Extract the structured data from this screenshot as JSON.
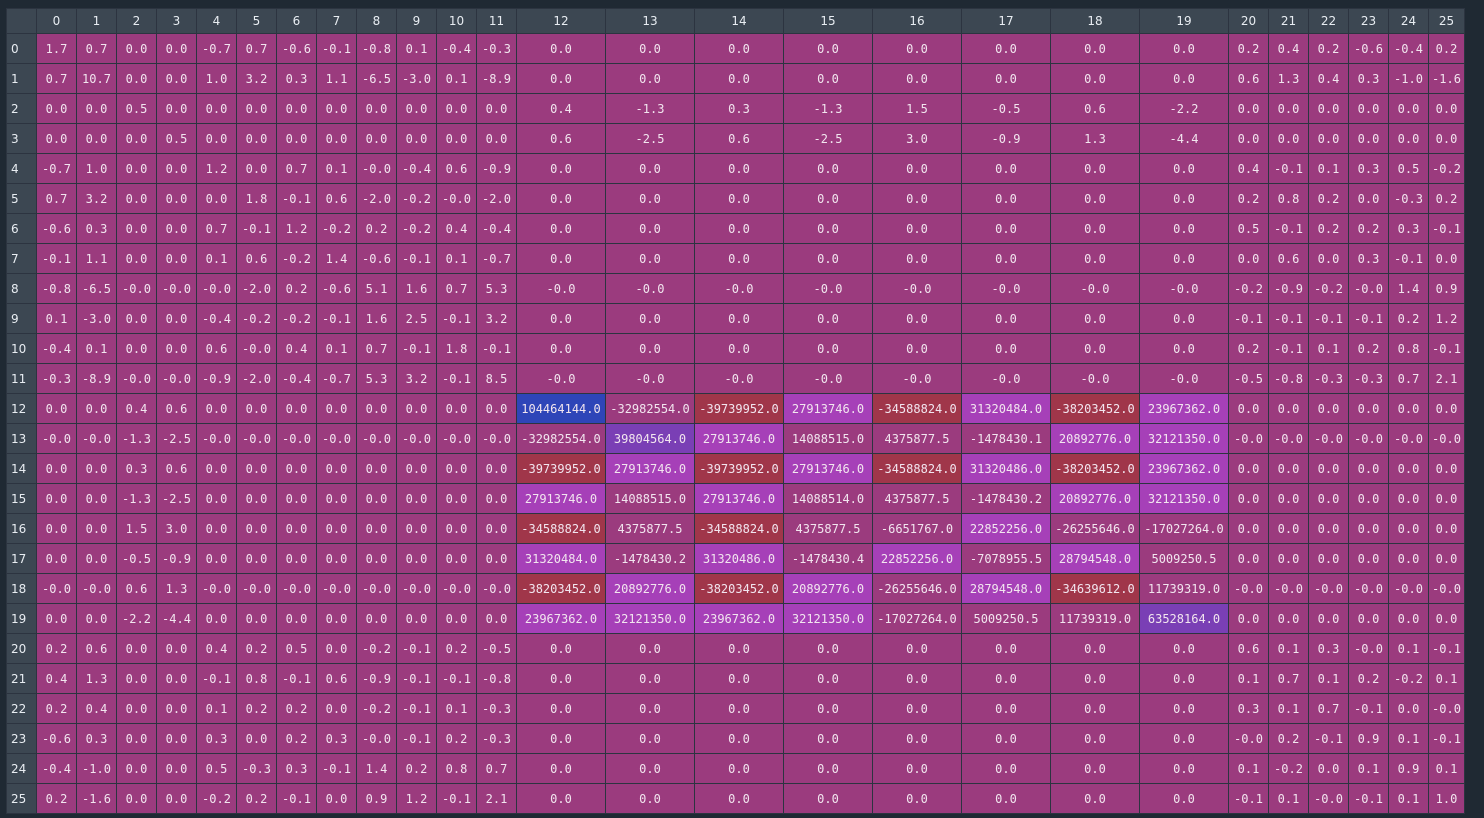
{
  "columns": [
    "0",
    "1",
    "2",
    "3",
    "4",
    "5",
    "6",
    "7",
    "8",
    "9",
    "10",
    "11",
    "12",
    "13",
    "14",
    "15",
    "16",
    "17",
    "18",
    "19",
    "20",
    "21",
    "22",
    "23",
    "24",
    "25"
  ],
  "rows": [
    {
      "label": "0",
      "cells": [
        "1.7",
        "0.7",
        "0.0",
        "0.0",
        "-0.7",
        "0.7",
        "-0.6",
        "-0.1",
        "-0.8",
        "0.1",
        "-0.4",
        "-0.3",
        "0.0",
        "0.0",
        "0.0",
        "0.0",
        "0.0",
        "0.0",
        "0.0",
        "0.0",
        "0.2",
        "0.4",
        "0.2",
        "-0.6",
        "-0.4",
        "0.2"
      ]
    },
    {
      "label": "1",
      "cells": [
        "0.7",
        "10.7",
        "0.0",
        "0.0",
        "1.0",
        "3.2",
        "0.3",
        "1.1",
        "-6.5",
        "-3.0",
        "0.1",
        "-8.9",
        "0.0",
        "0.0",
        "0.0",
        "0.0",
        "0.0",
        "0.0",
        "0.0",
        "0.0",
        "0.6",
        "1.3",
        "0.4",
        "0.3",
        "-1.0",
        "-1.6"
      ]
    },
    {
      "label": "2",
      "cells": [
        "0.0",
        "0.0",
        "0.5",
        "0.0",
        "0.0",
        "0.0",
        "0.0",
        "0.0",
        "0.0",
        "0.0",
        "0.0",
        "0.0",
        "0.4",
        "-1.3",
        "0.3",
        "-1.3",
        "1.5",
        "-0.5",
        "0.6",
        "-2.2",
        "0.0",
        "0.0",
        "0.0",
        "0.0",
        "0.0",
        "0.0"
      ]
    },
    {
      "label": "3",
      "cells": [
        "0.0",
        "0.0",
        "0.0",
        "0.5",
        "0.0",
        "0.0",
        "0.0",
        "0.0",
        "0.0",
        "0.0",
        "0.0",
        "0.0",
        "0.6",
        "-2.5",
        "0.6",
        "-2.5",
        "3.0",
        "-0.9",
        "1.3",
        "-4.4",
        "0.0",
        "0.0",
        "0.0",
        "0.0",
        "0.0",
        "0.0"
      ]
    },
    {
      "label": "4",
      "cells": [
        "-0.7",
        "1.0",
        "0.0",
        "0.0",
        "1.2",
        "0.0",
        "0.7",
        "0.1",
        "-0.0",
        "-0.4",
        "0.6",
        "-0.9",
        "0.0",
        "0.0",
        "0.0",
        "0.0",
        "0.0",
        "0.0",
        "0.0",
        "0.0",
        "0.4",
        "-0.1",
        "0.1",
        "0.3",
        "0.5",
        "-0.2"
      ]
    },
    {
      "label": "5",
      "cells": [
        "0.7",
        "3.2",
        "0.0",
        "0.0",
        "0.0",
        "1.8",
        "-0.1",
        "0.6",
        "-2.0",
        "-0.2",
        "-0.0",
        "-2.0",
        "0.0",
        "0.0",
        "0.0",
        "0.0",
        "0.0",
        "0.0",
        "0.0",
        "0.0",
        "0.2",
        "0.8",
        "0.2",
        "0.0",
        "-0.3",
        "0.2"
      ]
    },
    {
      "label": "6",
      "cells": [
        "-0.6",
        "0.3",
        "0.0",
        "0.0",
        "0.7",
        "-0.1",
        "1.2",
        "-0.2",
        "0.2",
        "-0.2",
        "0.4",
        "-0.4",
        "0.0",
        "0.0",
        "0.0",
        "0.0",
        "0.0",
        "0.0",
        "0.0",
        "0.0",
        "0.5",
        "-0.1",
        "0.2",
        "0.2",
        "0.3",
        "-0.1"
      ]
    },
    {
      "label": "7",
      "cells": [
        "-0.1",
        "1.1",
        "0.0",
        "0.0",
        "0.1",
        "0.6",
        "-0.2",
        "1.4",
        "-0.6",
        "-0.1",
        "0.1",
        "-0.7",
        "0.0",
        "0.0",
        "0.0",
        "0.0",
        "0.0",
        "0.0",
        "0.0",
        "0.0",
        "0.0",
        "0.6",
        "0.0",
        "0.3",
        "-0.1",
        "0.0"
      ]
    },
    {
      "label": "8",
      "cells": [
        "-0.8",
        "-6.5",
        "-0.0",
        "-0.0",
        "-0.0",
        "-2.0",
        "0.2",
        "-0.6",
        "5.1",
        "1.6",
        "0.7",
        "5.3",
        "-0.0",
        "-0.0",
        "-0.0",
        "-0.0",
        "-0.0",
        "-0.0",
        "-0.0",
        "-0.0",
        "-0.2",
        "-0.9",
        "-0.2",
        "-0.0",
        "1.4",
        "0.9"
      ]
    },
    {
      "label": "9",
      "cells": [
        "0.1",
        "-3.0",
        "0.0",
        "0.0",
        "-0.4",
        "-0.2",
        "-0.2",
        "-0.1",
        "1.6",
        "2.5",
        "-0.1",
        "3.2",
        "0.0",
        "0.0",
        "0.0",
        "0.0",
        "0.0",
        "0.0",
        "0.0",
        "0.0",
        "-0.1",
        "-0.1",
        "-0.1",
        "-0.1",
        "0.2",
        "1.2"
      ]
    },
    {
      "label": "10",
      "cells": [
        "-0.4",
        "0.1",
        "0.0",
        "0.0",
        "0.6",
        "-0.0",
        "0.4",
        "0.1",
        "0.7",
        "-0.1",
        "1.8",
        "-0.1",
        "0.0",
        "0.0",
        "0.0",
        "0.0",
        "0.0",
        "0.0",
        "0.0",
        "0.0",
        "0.2",
        "-0.1",
        "0.1",
        "0.2",
        "0.8",
        "-0.1"
      ]
    },
    {
      "label": "11",
      "cells": [
        "-0.3",
        "-8.9",
        "-0.0",
        "-0.0",
        "-0.9",
        "-2.0",
        "-0.4",
        "-0.7",
        "5.3",
        "3.2",
        "-0.1",
        "8.5",
        "-0.0",
        "-0.0",
        "-0.0",
        "-0.0",
        "-0.0",
        "-0.0",
        "-0.0",
        "-0.0",
        "-0.5",
        "-0.8",
        "-0.3",
        "-0.3",
        "0.7",
        "2.1"
      ]
    },
    {
      "label": "12",
      "cells": [
        "0.0",
        "0.0",
        "0.4",
        "0.6",
        "0.0",
        "0.0",
        "0.0",
        "0.0",
        "0.0",
        "0.0",
        "0.0",
        "0.0",
        "104464144.0",
        "-32982554.0",
        "-39739952.0",
        "27913746.0",
        "-34588824.0",
        "31320484.0",
        "-38203452.0",
        "23967362.0",
        "0.0",
        "0.0",
        "0.0",
        "0.0",
        "0.0",
        "0.0"
      ]
    },
    {
      "label": "13",
      "cells": [
        "-0.0",
        "-0.0",
        "-1.3",
        "-2.5",
        "-0.0",
        "-0.0",
        "-0.0",
        "-0.0",
        "-0.0",
        "-0.0",
        "-0.0",
        "-0.0",
        "-32982554.0",
        "39804564.0",
        "27913746.0",
        "14088515.0",
        "4375877.5",
        "-1478430.1",
        "20892776.0",
        "32121350.0",
        "-0.0",
        "-0.0",
        "-0.0",
        "-0.0",
        "-0.0",
        "-0.0"
      ]
    },
    {
      "label": "14",
      "cells": [
        "0.0",
        "0.0",
        "0.3",
        "0.6",
        "0.0",
        "0.0",
        "0.0",
        "0.0",
        "0.0",
        "0.0",
        "0.0",
        "0.0",
        "-39739952.0",
        "27913746.0",
        "-39739952.0",
        "27913746.0",
        "-34588824.0",
        "31320486.0",
        "-38203452.0",
        "23967362.0",
        "0.0",
        "0.0",
        "0.0",
        "0.0",
        "0.0",
        "0.0"
      ]
    },
    {
      "label": "15",
      "cells": [
        "0.0",
        "0.0",
        "-1.3",
        "-2.5",
        "0.0",
        "0.0",
        "0.0",
        "0.0",
        "0.0",
        "0.0",
        "0.0",
        "0.0",
        "27913746.0",
        "14088515.0",
        "27913746.0",
        "14088514.0",
        "4375877.5",
        "-1478430.2",
        "20892776.0",
        "32121350.0",
        "0.0",
        "0.0",
        "0.0",
        "0.0",
        "0.0",
        "0.0"
      ]
    },
    {
      "label": "16",
      "cells": [
        "0.0",
        "0.0",
        "1.5",
        "3.0",
        "0.0",
        "0.0",
        "0.0",
        "0.0",
        "0.0",
        "0.0",
        "0.0",
        "0.0",
        "-34588824.0",
        "4375877.5",
        "-34588824.0",
        "4375877.5",
        "-6651767.0",
        "22852256.0",
        "-26255646.0",
        "-17027264.0",
        "0.0",
        "0.0",
        "0.0",
        "0.0",
        "0.0",
        "0.0"
      ]
    },
    {
      "label": "17",
      "cells": [
        "0.0",
        "0.0",
        "-0.5",
        "-0.9",
        "0.0",
        "0.0",
        "0.0",
        "0.0",
        "0.0",
        "0.0",
        "0.0",
        "0.0",
        "31320484.0",
        "-1478430.2",
        "31320486.0",
        "-1478430.4",
        "22852256.0",
        "-7078955.5",
        "28794548.0",
        "5009250.5",
        "0.0",
        "0.0",
        "0.0",
        "0.0",
        "0.0",
        "0.0"
      ]
    },
    {
      "label": "18",
      "cells": [
        "-0.0",
        "-0.0",
        "0.6",
        "1.3",
        "-0.0",
        "-0.0",
        "-0.0",
        "-0.0",
        "-0.0",
        "-0.0",
        "-0.0",
        "-0.0",
        "-38203452.0",
        "20892776.0",
        "-38203452.0",
        "20892776.0",
        "-26255646.0",
        "28794548.0",
        "-34639612.0",
        "11739319.0",
        "-0.0",
        "-0.0",
        "-0.0",
        "-0.0",
        "-0.0",
        "-0.0"
      ]
    },
    {
      "label": "19",
      "cells": [
        "0.0",
        "0.0",
        "-2.2",
        "-4.4",
        "0.0",
        "0.0",
        "0.0",
        "0.0",
        "0.0",
        "0.0",
        "0.0",
        "0.0",
        "23967362.0",
        "32121350.0",
        "23967362.0",
        "32121350.0",
        "-17027264.0",
        "5009250.5",
        "11739319.0",
        "63528164.0",
        "0.0",
        "0.0",
        "0.0",
        "0.0",
        "0.0",
        "0.0"
      ]
    },
    {
      "label": "20",
      "cells": [
        "0.2",
        "0.6",
        "0.0",
        "0.0",
        "0.4",
        "0.2",
        "0.5",
        "0.0",
        "-0.2",
        "-0.1",
        "0.2",
        "-0.5",
        "0.0",
        "0.0",
        "0.0",
        "0.0",
        "0.0",
        "0.0",
        "0.0",
        "0.0",
        "0.6",
        "0.1",
        "0.3",
        "-0.0",
        "0.1",
        "-0.1"
      ]
    },
    {
      "label": "21",
      "cells": [
        "0.4",
        "1.3",
        "0.0",
        "0.0",
        "-0.1",
        "0.8",
        "-0.1",
        "0.6",
        "-0.9",
        "-0.1",
        "-0.1",
        "-0.8",
        "0.0",
        "0.0",
        "0.0",
        "0.0",
        "0.0",
        "0.0",
        "0.0",
        "0.0",
        "0.1",
        "0.7",
        "0.1",
        "0.2",
        "-0.2",
        "0.1"
      ]
    },
    {
      "label": "22",
      "cells": [
        "0.2",
        "0.4",
        "0.0",
        "0.0",
        "0.1",
        "0.2",
        "0.2",
        "0.0",
        "-0.2",
        "-0.1",
        "0.1",
        "-0.3",
        "0.0",
        "0.0",
        "0.0",
        "0.0",
        "0.0",
        "0.0",
        "0.0",
        "0.0",
        "0.3",
        "0.1",
        "0.7",
        "-0.1",
        "0.0",
        "-0.0"
      ]
    },
    {
      "label": "23",
      "cells": [
        "-0.6",
        "0.3",
        "0.0",
        "0.0",
        "0.3",
        "0.0",
        "0.2",
        "0.3",
        "-0.0",
        "-0.1",
        "0.2",
        "-0.3",
        "0.0",
        "0.0",
        "0.0",
        "0.0",
        "0.0",
        "0.0",
        "0.0",
        "0.0",
        "-0.0",
        "0.2",
        "-0.1",
        "0.9",
        "0.1",
        "-0.1"
      ]
    },
    {
      "label": "24",
      "cells": [
        "-0.4",
        "-1.0",
        "0.0",
        "0.0",
        "0.5",
        "-0.3",
        "0.3",
        "-0.1",
        "1.4",
        "0.2",
        "0.8",
        "0.7",
        "0.0",
        "0.0",
        "0.0",
        "0.0",
        "0.0",
        "0.0",
        "0.0",
        "0.0",
        "0.1",
        "-0.2",
        "0.0",
        "0.1",
        "0.9",
        "0.1"
      ]
    },
    {
      "label": "25",
      "cells": [
        "0.2",
        "-1.6",
        "0.0",
        "0.0",
        "-0.2",
        "0.2",
        "-0.1",
        "0.0",
        "0.9",
        "1.2",
        "-0.1",
        "2.1",
        "0.0",
        "0.0",
        "0.0",
        "0.0",
        "0.0",
        "0.0",
        "0.0",
        "0.0",
        "-0.1",
        "0.1",
        "-0.0",
        "-0.1",
        "0.1",
        "1.0"
      ]
    }
  ],
  "colors": {
    "background": "#1f2933",
    "header_bg": "#3c4752",
    "header_text": "#e8edf2",
    "cell_default": "#9b3b7e",
    "cell_text": "#f2e6ef",
    "grid_line": "#2c3440",
    "cell_max": "#2e45b8",
    "cell_high": "#7a3fb5",
    "cell_mid": "#a640b8",
    "cell_neg": "#a0364a"
  },
  "color_scale_note_visible": false
}
